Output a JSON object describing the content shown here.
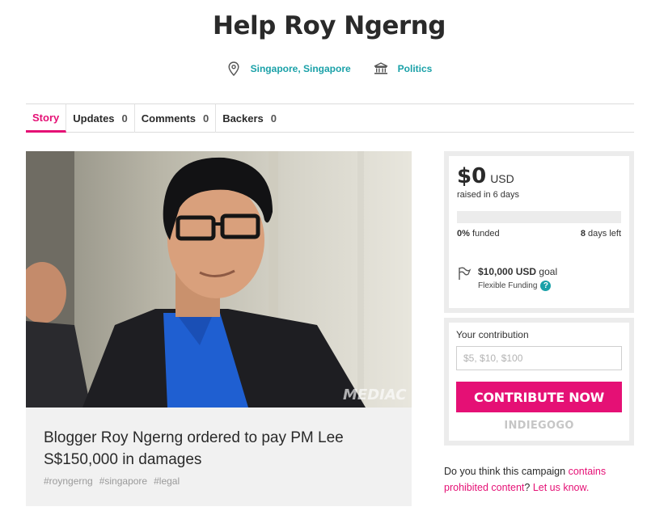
{
  "campaign": {
    "title": "Help Roy Ngerng",
    "location": "Singapore, Singapore",
    "category": "Politics"
  },
  "tabs": [
    {
      "label": "Story",
      "count": ""
    },
    {
      "label": "Updates",
      "count": "0"
    },
    {
      "label": "Comments",
      "count": "0"
    },
    {
      "label": "Backers",
      "count": "0"
    }
  ],
  "hero": {
    "watermark": "MEDIAC",
    "caption_title": "Blogger Roy Ngerng ordered to pay PM Lee S$150,000 in damages",
    "tags": [
      "#royngerng",
      "#singapore",
      "#legal"
    ]
  },
  "funding": {
    "amount": "$0",
    "currency": "USD",
    "raised_text": "raised in 6 days",
    "percent_funded": "0%",
    "funded_label": "funded",
    "days_left_value": "8",
    "days_left_label": "days left",
    "progress_fraction": 0,
    "goal_amount": "$10,000",
    "goal_currency": "USD",
    "goal_label": "goal",
    "funding_type": "Flexible Funding",
    "help_glyph": "?"
  },
  "contribution": {
    "label": "Your contribution",
    "placeholder": "$5, $10, $100",
    "button": "CONTRIBUTE NOW",
    "brand": "INDIEGOGO"
  },
  "report": {
    "prefix": "Do you think this campaign",
    "link1": "contains prohibited content",
    "mid": "?",
    "link2": "Let us know."
  },
  "colors": {
    "accent": "#e51075",
    "teal": "#1aa1a8"
  },
  "icons": {
    "location": "map-pin-icon",
    "category": "building-icon",
    "goal": "flag-icon",
    "help": "question-icon"
  }
}
